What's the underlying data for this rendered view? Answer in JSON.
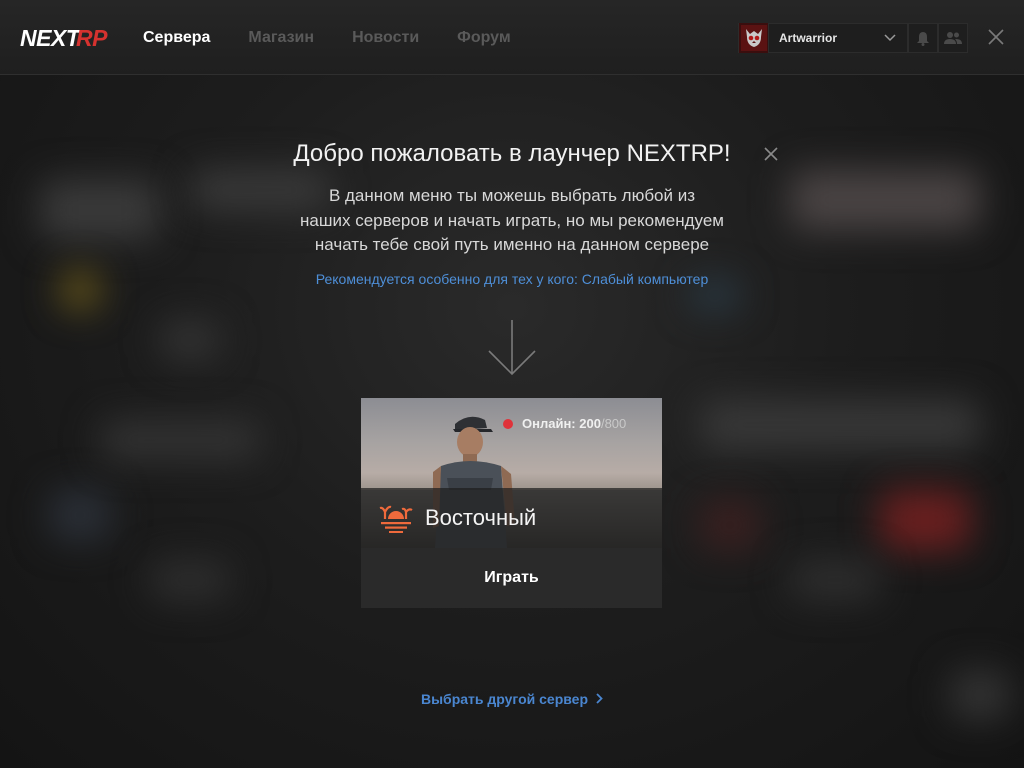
{
  "app": {
    "logo_text": "NEXTRP"
  },
  "nav": {
    "items": [
      {
        "label": "Сервера",
        "active": true
      },
      {
        "label": "Магазин",
        "active": false
      },
      {
        "label": "Новости",
        "active": false
      },
      {
        "label": "Форум",
        "active": false
      }
    ]
  },
  "user": {
    "name": "Artwarrior",
    "avatar_icon": "skull-avatar-icon"
  },
  "icons": {
    "notifications": "bell-icon",
    "friends": "friends-icon",
    "close_app": "close-icon"
  },
  "welcome": {
    "title": "Добро пожаловать в лаунчер NEXTRP!",
    "description_lines": [
      "В данном меню ты можешь выбрать любой из",
      "наших серверов и начать играть, но мы рекомендуем",
      "начать тебе свой путь именно на данном сервере"
    ],
    "recommendation": "Рекомендуется особенно для тех  у кого: Слабый компьютер"
  },
  "server_card": {
    "online_label": "Онлайн:",
    "online_current": "200",
    "online_max": "/800",
    "status_color": "#e0323a",
    "name": "Восточный",
    "icon": "sunset-island-icon",
    "play_label": "Играть"
  },
  "footer": {
    "other_server_label": "Выбрать другой сервер"
  },
  "colors": {
    "accent_blue": "#4e8fd8",
    "logo_red": "#d6322f"
  }
}
